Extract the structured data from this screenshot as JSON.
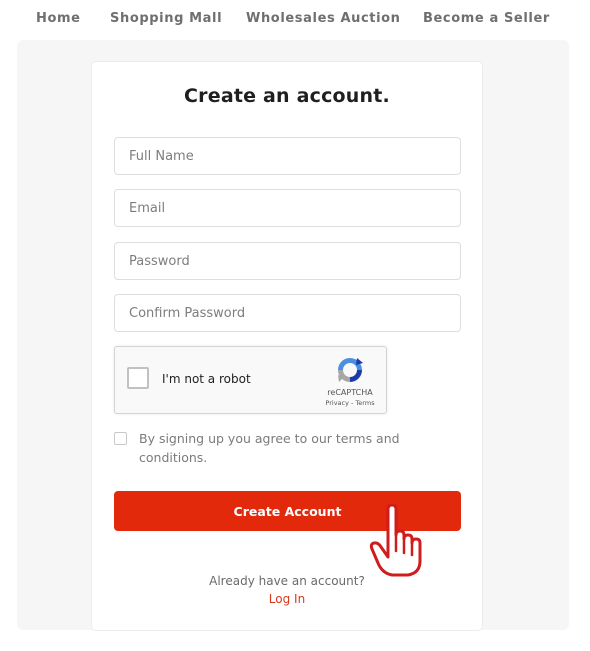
{
  "nav": {
    "items": [
      {
        "label": "Home"
      },
      {
        "label": "Shopping Mall"
      },
      {
        "label": "Wholesales Auction"
      },
      {
        "label": "Become a Seller"
      }
    ]
  },
  "form": {
    "title": "Create an account.",
    "fields": {
      "full_name": {
        "placeholder": "Full Name",
        "value": ""
      },
      "email": {
        "placeholder": "Email",
        "value": ""
      },
      "password": {
        "placeholder": "Password",
        "value": ""
      },
      "confirm_password": {
        "placeholder": "Confirm Password",
        "value": ""
      }
    },
    "recaptcha": {
      "label": "I'm not a robot",
      "brand": "reCAPTCHA",
      "links": "Privacy - Terms",
      "icon": "recaptcha-logo-icon"
    },
    "terms": {
      "text": "By signing up you agree to our terms and conditions.",
      "checked": false
    },
    "submit_label": "Create Account",
    "login_prompt": "Already have an account?",
    "login_link": "Log In"
  },
  "overlay": {
    "icon": "pointing-hand-icon"
  },
  "colors": {
    "accent": "#e3290b",
    "link": "#d63a1c",
    "hand_outline": "#d01c1c",
    "nav_text": "#6f6f6f"
  }
}
